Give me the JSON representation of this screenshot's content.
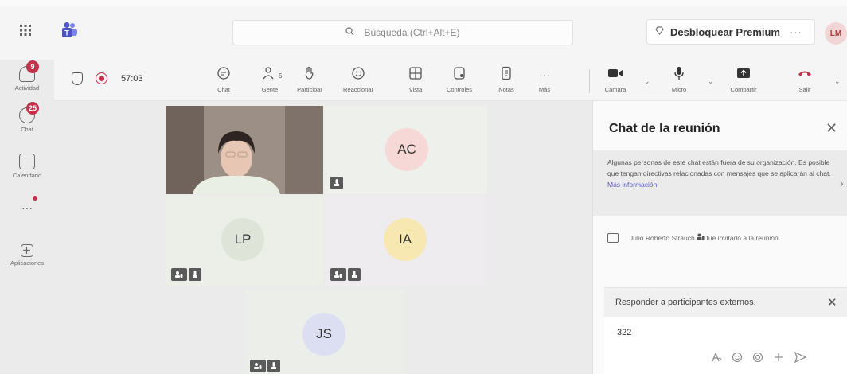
{
  "header": {
    "search_placeholder": "Búsqueda (Ctrl+Alt+E)",
    "premium_label": "Desbloquear Premium",
    "more_label": "···",
    "user_initials": "LM"
  },
  "rail": {
    "items": [
      {
        "label": "Actividad",
        "badge": "9",
        "icon": "bell-icon"
      },
      {
        "label": "Chat",
        "badge": "25",
        "icon": "chat-icon"
      },
      {
        "label": "Calendario",
        "badge": "",
        "icon": "calendar-icon"
      },
      {
        "label": "···",
        "badge": "",
        "icon": "more-icon"
      },
      {
        "label": "Aplicaciones",
        "badge": "",
        "icon": "apps-icon"
      }
    ]
  },
  "meeting": {
    "timer": "57:03",
    "people_count": "5",
    "tools": [
      {
        "label": "Chat",
        "icon": "chat-icon"
      },
      {
        "label": "Gente",
        "icon": "people-icon"
      },
      {
        "label": "Participar",
        "icon": "raise-hand-icon"
      },
      {
        "label": "Reaccionar",
        "icon": "emoji-icon"
      },
      {
        "label": "Vista",
        "icon": "grid-icon"
      },
      {
        "label": "Controles",
        "icon": "controls-icon"
      },
      {
        "label": "Notas",
        "icon": "notes-icon"
      },
      {
        "label": "Más",
        "icon": "more-icon"
      }
    ],
    "media": [
      {
        "label": "Cámara",
        "icon": "camera-icon"
      },
      {
        "label": "Micro",
        "icon": "mic-icon"
      },
      {
        "label": "Compartir",
        "icon": "share-icon"
      },
      {
        "label": "Salir",
        "icon": "hangup-icon"
      }
    ]
  },
  "participants": [
    {
      "initials": "",
      "kind": "video"
    },
    {
      "initials": "AC",
      "kind": "avatar"
    },
    {
      "initials": "LP",
      "kind": "avatar"
    },
    {
      "initials": "IA",
      "kind": "avatar"
    },
    {
      "initials": "JS",
      "kind": "avatar"
    }
  ],
  "chat": {
    "title": "Chat de la reunión",
    "notice": "Algunas personas de este chat están fuera de su organización. Es posible que tengan directivas relacionadas con mensajes que se aplicarán al chat.",
    "notice_link": "Más información",
    "event_name": "Julio Roberto Strauch",
    "event_text": "fue invitado a la reunión.",
    "reply_header": "Responder a participantes externos.",
    "reply_value": "322"
  },
  "colors": {
    "accent": "#5b5fc7",
    "badge": "#c4314b",
    "hangup": "#c4314b"
  }
}
